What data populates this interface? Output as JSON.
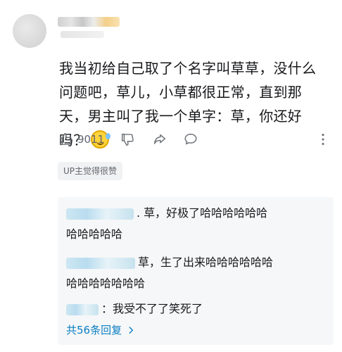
{
  "comment": {
    "text": "我当初给自己取了个名字叫草草，没什么问题吧，草儿，小草都很正常，直到那天，男主叫了我一个单字：草，你还好吗？",
    "like_count": "9011",
    "up_badge": "UP主觉得很赞"
  },
  "replies": [
    {
      "line1": ". 草，好极了哈哈哈哈哈哈",
      "line2": "哈哈哈哈哈"
    },
    {
      "line1": "草，生了出来哈哈哈哈哈哈",
      "line2": "哈哈哈哈哈哈哈"
    },
    {
      "line1": "：我受不了了笑死了",
      "line2": ""
    }
  ],
  "more_replies_label": "共56条回复",
  "icons": [
    "thumb-up-icon",
    "thumb-down-icon",
    "share-icon",
    "comment-icon",
    "more-icon",
    "chevron-right-icon",
    "sweat-emoji-icon"
  ],
  "colors": {
    "link": "#0a7ec2",
    "reply_bg": "#f6f7f8",
    "text": "#18191c",
    "muted": "#61666d"
  }
}
